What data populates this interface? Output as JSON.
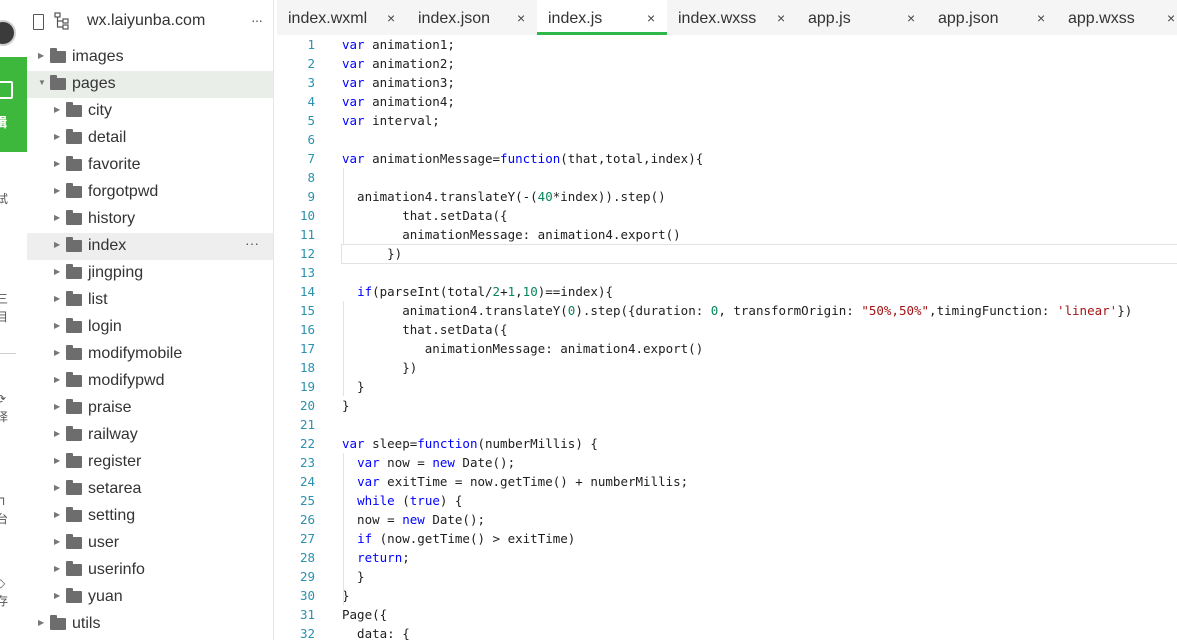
{
  "sidebar": {
    "edit_label": "辑",
    "items": [
      "试",
      "三\n目",
      "译",
      "台",
      "存"
    ],
    "glyphs": [
      "›",
      "⟳",
      "⊓",
      "◇"
    ]
  },
  "tree": {
    "title": "wx.laiyunba.com",
    "more": "···",
    "nodes": [
      {
        "name": "images",
        "depth": 0,
        "open": false
      },
      {
        "name": "pages",
        "depth": 0,
        "open": true
      },
      {
        "name": "city",
        "depth": 1,
        "open": false
      },
      {
        "name": "detail",
        "depth": 1,
        "open": false
      },
      {
        "name": "favorite",
        "depth": 1,
        "open": false
      },
      {
        "name": "forgotpwd",
        "depth": 1,
        "open": false
      },
      {
        "name": "history",
        "depth": 1,
        "open": false
      },
      {
        "name": "index",
        "depth": 1,
        "open": false
      },
      {
        "name": "jingping",
        "depth": 1,
        "open": false
      },
      {
        "name": "list",
        "depth": 1,
        "open": false
      },
      {
        "name": "login",
        "depth": 1,
        "open": false
      },
      {
        "name": "modifymobile",
        "depth": 1,
        "open": false
      },
      {
        "name": "modifypwd",
        "depth": 1,
        "open": false
      },
      {
        "name": "praise",
        "depth": 1,
        "open": false
      },
      {
        "name": "railway",
        "depth": 1,
        "open": false
      },
      {
        "name": "register",
        "depth": 1,
        "open": false
      },
      {
        "name": "setarea",
        "depth": 1,
        "open": false
      },
      {
        "name": "setting",
        "depth": 1,
        "open": false
      },
      {
        "name": "user",
        "depth": 1,
        "open": false
      },
      {
        "name": "userinfo",
        "depth": 1,
        "open": false
      },
      {
        "name": "yuan",
        "depth": 1,
        "open": false
      },
      {
        "name": "utils",
        "depth": 0,
        "open": false
      }
    ],
    "selected": "pages",
    "hovered": "index",
    "hover_more": "···"
  },
  "tabs": [
    {
      "name": "index.wxml",
      "close": "×",
      "active": false
    },
    {
      "name": "index.json",
      "close": "×",
      "active": false
    },
    {
      "name": "index.js",
      "close": "×",
      "active": true
    },
    {
      "name": "index.wxss",
      "close": "×",
      "active": false
    },
    {
      "name": "app.js",
      "close": "×",
      "active": false
    },
    {
      "name": "app.json",
      "close": "×",
      "active": false
    },
    {
      "name": "app.wxss",
      "close": "×",
      "active": false
    }
  ],
  "editor": {
    "active_line": 12,
    "lines": [
      "var animation1;",
      "var animation2;",
      "var animation3;",
      "var animation4;",
      "var interval;",
      "",
      "var animationMessage=function(that,total,index){",
      "",
      "  animation4.translateY(-(40*index)).step()",
      "        that.setData({",
      "        animationMessage: animation4.export()",
      "      })",
      "",
      "  if(parseInt(total/2+1,10)==index){",
      "        animation4.translateY(0).step({duration: 0, transformOrigin: \"50%,50%\",timingFunction: 'linear'})",
      "        that.setData({",
      "           animationMessage: animation4.export()",
      "        })",
      "  }",
      "}",
      "",
      "var sleep=function(numberMillis) {",
      "  var now = new Date();",
      "  var exitTime = now.getTime() + numberMillis;",
      "  while (true) {",
      "  now = new Date();",
      "  if (now.getTime() > exitTime)",
      "  return;",
      "  }",
      "}",
      "Page({",
      "  data: {"
    ]
  },
  "colors": {
    "keyword": "#0000ff",
    "number": "#098658",
    "string": "#a31515",
    "line_number": "#2b91af",
    "accent": "#2fb84a",
    "sidebar_green": "#3db83d"
  }
}
